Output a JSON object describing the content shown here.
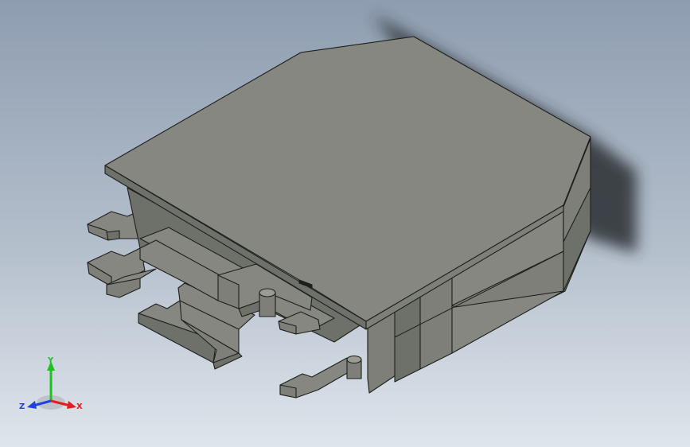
{
  "viewport": {
    "background_top": "#8e9db0",
    "background_bottom": "#dfe5ec"
  },
  "model": {
    "face_top": "#858780",
    "face_side": "#7d7f78",
    "face_dark": "#6e706a",
    "face_light": "#9a9c94",
    "edge": "#1e1f1c",
    "shadow": "#2a2d30"
  },
  "triad": {
    "x_label": "X",
    "y_label": "Y",
    "z_label": "Z",
    "x_color": "#e02020",
    "y_color": "#20c020",
    "z_color": "#2040e0"
  }
}
